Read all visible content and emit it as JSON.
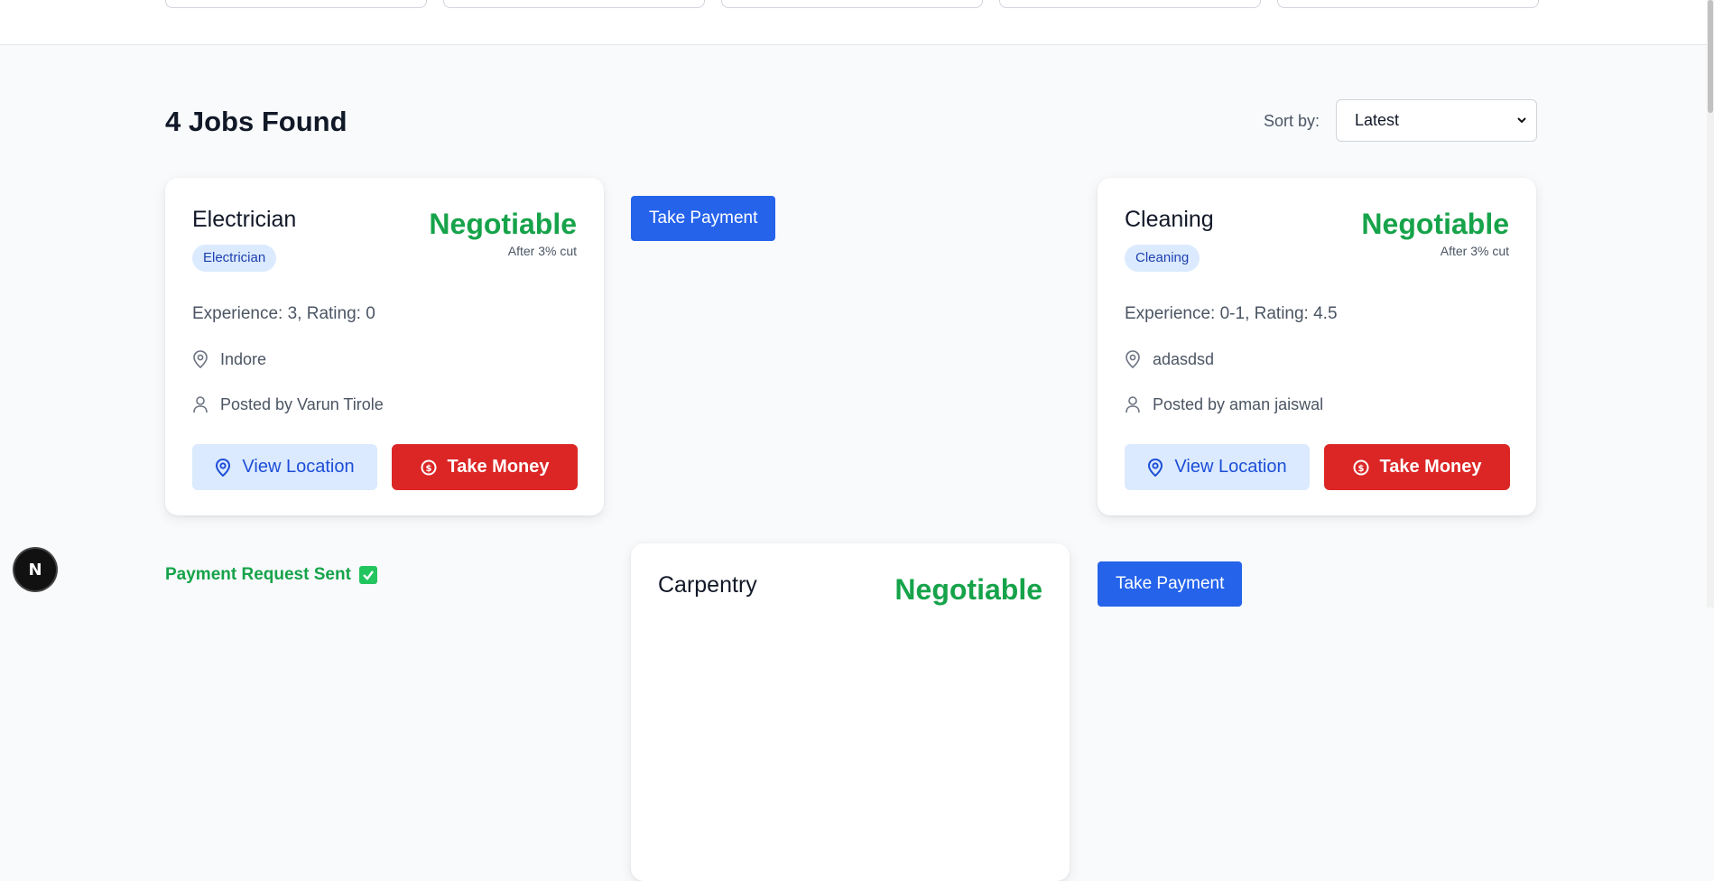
{
  "results": {
    "heading": "4 Jobs Found",
    "sort_label": "Sort by:",
    "sort_value": "Latest"
  },
  "jobs": [
    {
      "title": "Electrician",
      "tag": "Electrician",
      "price": "Negotiable",
      "price_note": "After 3% cut",
      "meta": "Experience: 3, Rating: 0",
      "location": "Indore",
      "posted_by": "Posted by Varun Tirole",
      "view_label": "View Location",
      "money_label": "Take Money"
    },
    {
      "title": "Cleaning",
      "tag": "Cleaning",
      "price": "Negotiable",
      "price_note": "After 3% cut",
      "meta": "Experience: 0-1, Rating: 4.5",
      "location": "adasdsd",
      "posted_by": "Posted by aman jaiswal",
      "view_label": "View Location",
      "money_label": "Take Money"
    },
    {
      "title": "Carpentry",
      "price": "Negotiable"
    }
  ],
  "payment_button_label": "Take Payment",
  "payment_sent_text": "Payment Request Sent",
  "next_logo": "N",
  "colors": {
    "negotiable": "#16a34a",
    "take_money": "#dc2626",
    "take_payment": "#2563eb",
    "view_location_bg": "#dbeafe"
  }
}
